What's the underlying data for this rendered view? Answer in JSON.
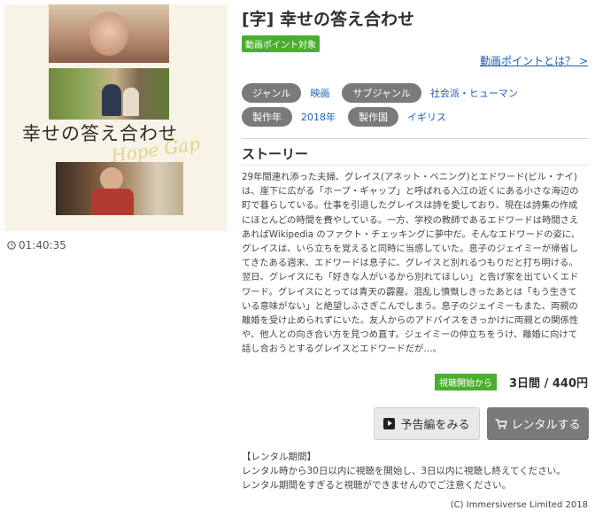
{
  "poster": {
    "title_jp": "幸せの答え合わせ",
    "title_en": "Hope Gap"
  },
  "duration": "01:40:35",
  "movie": {
    "title": "[字] 幸せの答え合わせ",
    "point_badge": "動画ポイント対象",
    "point_link": "動画ポイントとは？ >"
  },
  "meta": {
    "genre_label": "ジャンル",
    "genre_value": "映画",
    "subgenre_label": "サブジャンル",
    "subgenre_value": "社会派・ヒューマン",
    "year_label": "製作年",
    "year_value": "2018年",
    "country_label": "製作国",
    "country_value": "イギリス"
  },
  "story": {
    "heading": "ストーリー",
    "lines": [
      "29年間連れ添った夫婦、グレイス(アネット・ベニング)とエドワード(ビル・ナイ)",
      "は、崖下に広がる「ホープ・ギャップ」と呼ばれる入江の近くにある小さな海辺の",
      "町で暮らしている。仕事を引退したグレイスは詩を愛しており、現在は詩集の作成",
      "にほとんどの時間を費やしている。一方、学校の教師であるエドワードは時間さえ",
      "あればWikipedia のファクト・チェッキングに夢中だ。そんなエドワードの姿に、",
      "グレイスは、いら立ちを覚えると同時に当惑していた。息子のジェイミーが帰省し",
      "てきたある週末、エドワードは息子に、グレイスと別れるつもりだと打ち明ける。",
      "翌日、グレイスにも「好きな人がいるから別れてほしい」と告げ家を出ていくエド",
      "ワード。グレイスにとっては青天の霹靂。混乱し憤慨しきったあとは「もう生きて",
      "いる意味がない」と絶望しふさぎこんでしまう。息子のジェイミーもまた、両親の",
      "離婚を受け止められずにいた。友人からのアドバイスをきっかけに両親との関係性",
      "や、他人との向き合い方を見つめ直す。ジェイミーの仲立ちをうけ、離婚に向けて",
      "話し合おうとするグレイスとエドワードだが…。"
    ]
  },
  "pricing": {
    "from_label": "視聴開始から",
    "price": "3日間 / 440円"
  },
  "actions": {
    "trailer_label": "予告編をみる",
    "rental_label": "レンタルする"
  },
  "rental_info": {
    "heading": "【レンタル期間】",
    "line1": "レンタル時から30日以内に視聴を開始し、3日以内に視聴し終えてください。",
    "line2": "レンタル期間をすぎると視聴ができませんのでご注意ください。"
  },
  "copyright": "(C) Immersiverse Limited 2018",
  "colors": {
    "accent_green": "#4cae2f",
    "pill_gray": "#7a7a7a",
    "link_blue": "#1a5fb4"
  }
}
